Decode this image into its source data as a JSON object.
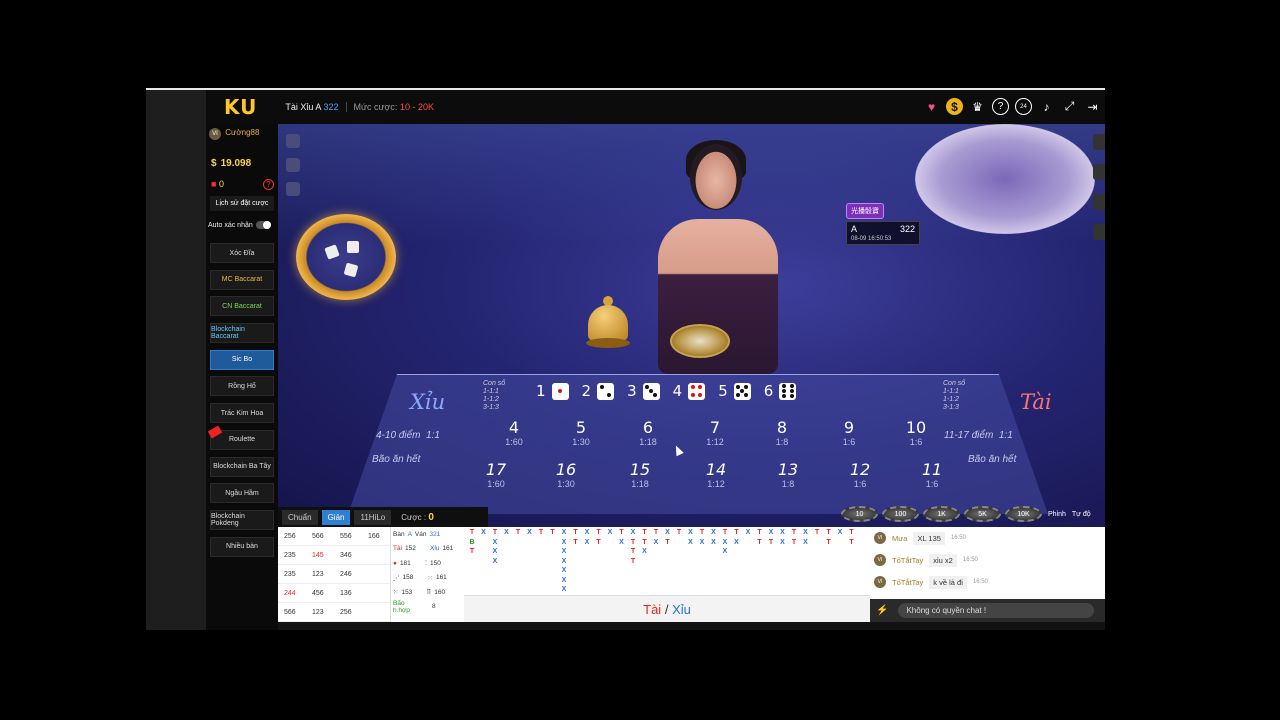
{
  "header": {
    "logo_main": "K",
    "logo_accent": "U",
    "game_title": "Tài Xỉu A",
    "game_round": "322",
    "bet_label": "Mức cược:",
    "bet_range": "10 - 20K",
    "icons": [
      "heart-icon",
      "coin-icon",
      "trophy-icon",
      "help-icon",
      "support-24-icon",
      "volume-icon",
      "fullscreen-icon",
      "exit-icon"
    ]
  },
  "user": {
    "vip": "VI",
    "name": "Cường88",
    "currency": "$",
    "balance": "19.098",
    "gift_count": "0",
    "history_button": "Lịch sử đặt cược",
    "auto_confirm": "Auto xác nhận"
  },
  "games": [
    {
      "label": "Xóc Đĩa",
      "color": "#dddddd"
    },
    {
      "label": "MC Baccarat",
      "color": "#e8b94a"
    },
    {
      "label": "CN Baccarat",
      "color": "#7bdc4e"
    },
    {
      "label": "Blockchain Baccarat",
      "color": "#6cc7ff"
    },
    {
      "label": "Sic Bo",
      "color": "#ffffff"
    },
    {
      "label": "Rồng Hổ",
      "color": "#dddddd"
    },
    {
      "label": "Trác Kim Hoa",
      "color": "#dddddd"
    },
    {
      "label": "Roulette",
      "color": "#dddddd"
    },
    {
      "label": "Blockchain Ba Tây",
      "color": "#dddddd"
    },
    {
      "label": "Ngầu Hầm",
      "color": "#dddddd"
    },
    {
      "label": "Blockchain Pokdeng",
      "color": "#dddddd"
    },
    {
      "label": "Nhiều bàn",
      "color": "#dddddd"
    }
  ],
  "round_tag": {
    "brand": "光播骰寶",
    "table": "A",
    "round": "322",
    "time": "08-09 16:50:53"
  },
  "board": {
    "xiu": "Xỉu",
    "tai": "Tài",
    "xiu_range": "4-10 điểm",
    "xiu_odds": "1:1",
    "tai_range": "11-17 điểm",
    "tai_odds": "1:1",
    "triple_note": "Bão ăn hết",
    "con_so": "Con số",
    "odds_lines": [
      "1-1:1",
      "1-1:2",
      "3-1:3"
    ],
    "singles": [
      "1",
      "2",
      "3",
      "4",
      "5",
      "6"
    ],
    "top_row": [
      {
        "v": "4",
        "o": "1:60"
      },
      {
        "v": "5",
        "o": "1:30"
      },
      {
        "v": "6",
        "o": "1:18"
      },
      {
        "v": "7",
        "o": "1:12"
      },
      {
        "v": "8",
        "o": "1:8"
      },
      {
        "v": "9",
        "o": "1:6"
      },
      {
        "v": "10",
        "o": "1:6"
      }
    ],
    "bottom_row": [
      {
        "v": "17",
        "o": "1:60"
      },
      {
        "v": "16",
        "o": "1:30"
      },
      {
        "v": "15",
        "o": "1:18"
      },
      {
        "v": "14",
        "o": "1:12"
      },
      {
        "v": "13",
        "o": "1:8"
      },
      {
        "v": "12",
        "o": "1:6"
      },
      {
        "v": "11",
        "o": "1:6"
      }
    ]
  },
  "tabs": {
    "t1": "Chuẩn",
    "t2": "Giản",
    "t3": "11HiLo",
    "bet_label": "Cược :",
    "bet_value": "0"
  },
  "chips": [
    "10",
    "100",
    "1K",
    "5K",
    "10K"
  ],
  "chip_actions": [
    "Phỉnh",
    "Tự độ"
  ],
  "number_history": [
    [
      "256",
      "566",
      "556",
      "166"
    ],
    [
      "235",
      "145",
      "346",
      ""
    ],
    [
      "235",
      "123",
      "246",
      ""
    ],
    [
      "244",
      "456",
      "136",
      ""
    ],
    [
      "566",
      "123",
      "256",
      ""
    ]
  ],
  "dice_stats": {
    "head_ban": "Bàn",
    "head_a": "A",
    "head_van": "Ván",
    "head_321": "321",
    "tai_lbl": "Tài",
    "tai_v": "152",
    "xiu_lbl": "Xỉu",
    "xiu_v": "161",
    "r1a": "181",
    "r1b": "150",
    "r2a": "158",
    "r2b": "161",
    "r3a": "153",
    "r3b": "160",
    "bao_lbl": "Bão h.hợp",
    "bao_v": "8"
  },
  "roadmap_label_tai": "Tài",
  "roadmap_sep": "/",
  "roadmap_label_xiu": "Xỉu",
  "chat": [
    {
      "vip": "VI",
      "name": "Mưa",
      "text": "XL 135",
      "time": "16:50"
    },
    {
      "vip": "VI",
      "name": "TốTắtTay",
      "text": "xỉu x2",
      "time": "16:50"
    },
    {
      "vip": "VI",
      "name": "TốTắtTay",
      "text": "k về là đi",
      "time": "16:50"
    }
  ],
  "chat_placeholder": "Không có quyền chat !"
}
